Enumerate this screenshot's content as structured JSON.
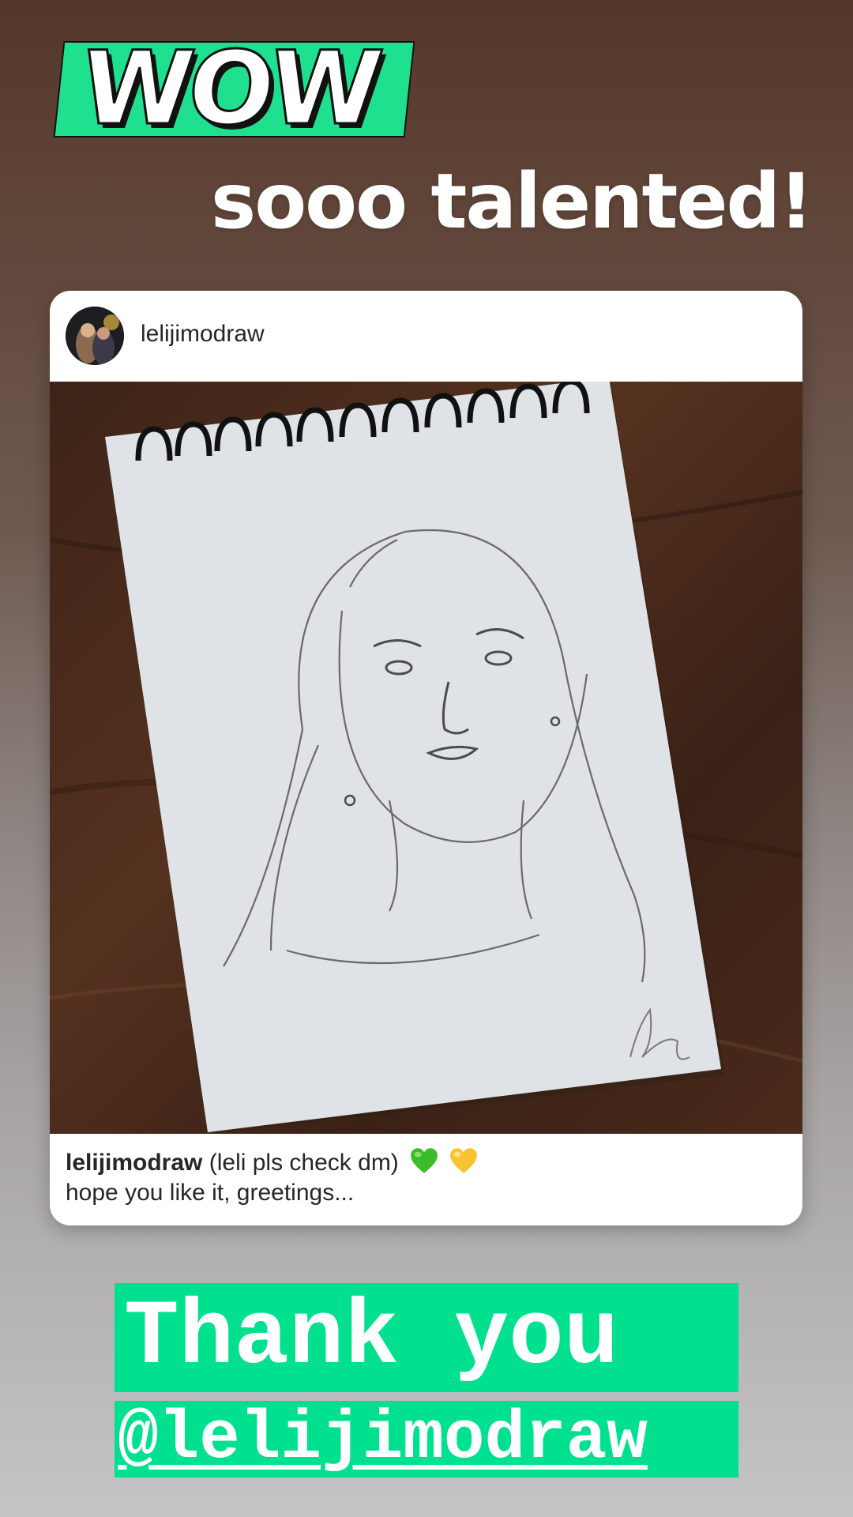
{
  "story": {
    "wow_sticker_text": "WOW",
    "headline": "sooo talented!"
  },
  "post": {
    "username": "lelijimodraw",
    "avatar_icon": "profile-photo-avatar",
    "caption": {
      "username": "lelijimodraw",
      "text": "(leli pls check dm)",
      "emojis": [
        "green-heart-icon",
        "yellow-heart-icon"
      ],
      "second_line": "hope you like it, greetings..."
    }
  },
  "thanks": {
    "line1": "Thank you",
    "mention": "@lelijimodraw"
  },
  "colors": {
    "accent_green": "#00e08f",
    "wow_green": "#1ee08e",
    "heart_green": "#3dbb2b",
    "heart_yellow": "#f7c331"
  }
}
